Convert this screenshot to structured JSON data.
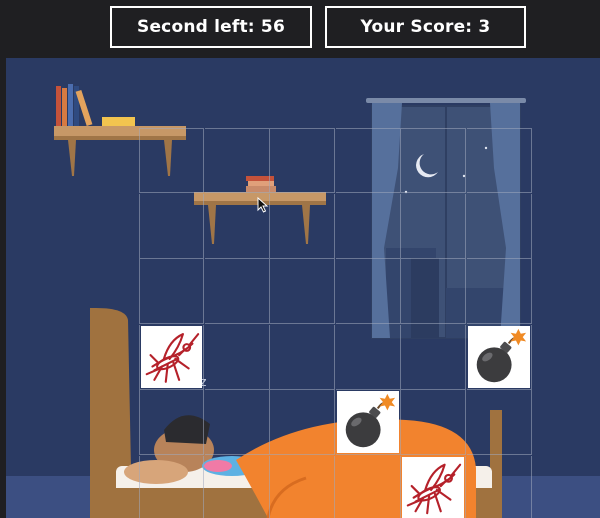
{
  "hud": {
    "timer_text": "Second left: 56",
    "score_text": "Your Score: 3"
  },
  "board": {
    "rows": 6,
    "cols": 6,
    "items": [
      {
        "row": 3,
        "col": 0,
        "kind": "mosquito"
      },
      {
        "row": 3,
        "col": 5,
        "kind": "bomb"
      },
      {
        "row": 4,
        "col": 3,
        "kind": "bomb"
      },
      {
        "row": 5,
        "col": 4,
        "kind": "mosquito"
      }
    ]
  },
  "scene": {
    "sleep_text": "z z",
    "icons": [
      "mosquito-icon",
      "bomb-icon",
      "moon-icon",
      "books-icon",
      "mouse-cursor-icon"
    ]
  },
  "colors": {
    "background": "#1f1f22",
    "wall": "#2a3a63",
    "window_glass": "#3e5176",
    "curtain": "#56709c",
    "bed_frame": "#a0723f",
    "blanket": "#f2832e",
    "mosquito": "#b5212a",
    "bomb": "#3c3c3e",
    "fuse_spark": "#f08a24"
  }
}
